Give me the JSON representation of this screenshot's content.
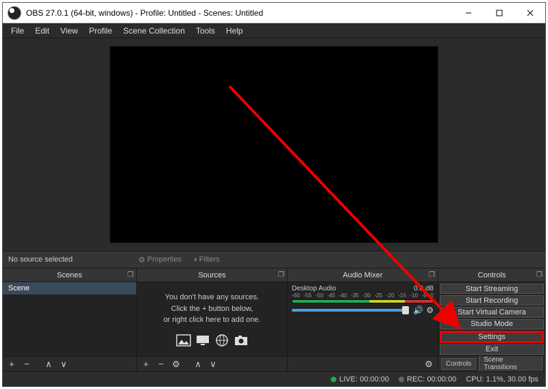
{
  "titlebar": {
    "text": "OBS 27.0.1 (64-bit, windows) - Profile: Untitled - Scenes: Untitled"
  },
  "menubar": [
    "File",
    "Edit",
    "View",
    "Profile",
    "Scene Collection",
    "Tools",
    "Help"
  ],
  "midbar": {
    "no_source": "No source selected",
    "properties": "Properties",
    "filters": "Filters"
  },
  "panels": {
    "scenes": {
      "title": "Scenes",
      "items": [
        "Scene"
      ]
    },
    "sources": {
      "title": "Sources",
      "empty1": "You don't have any sources.",
      "empty2": "Click the + button below,",
      "empty3": "or right click here to add one."
    },
    "mixer": {
      "title": "Audio Mixer",
      "track": "Desktop Audio",
      "readout": "0.0 dB",
      "ticks": [
        "-60",
        "-55",
        "-50",
        "-45",
        "-40",
        "-35",
        "-30",
        "-25",
        "-20",
        "-15",
        "-10",
        "-5",
        "0"
      ]
    },
    "controls": {
      "title": "Controls",
      "buttons": [
        "Start Streaming",
        "Start Recording",
        "Start Virtual Camera",
        "Studio Mode",
        "Settings",
        "Exit"
      ],
      "tabs": [
        "Controls",
        "Scene Transitions"
      ]
    }
  },
  "statusbar": {
    "live_label": "LIVE:",
    "live_time": "00:00:00",
    "rec_label": "REC:",
    "rec_time": "00:00:00",
    "cpu": "CPU: 1.1%, 30.00 fps"
  }
}
